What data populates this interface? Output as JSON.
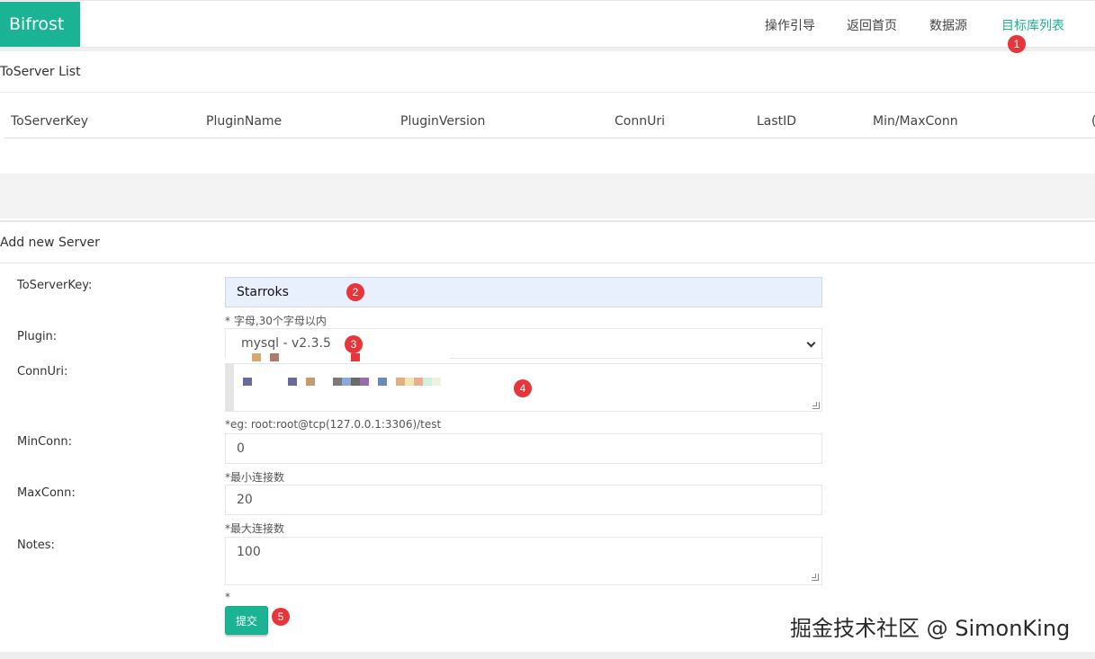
{
  "navbar": {
    "brand": "Bifrost",
    "items": [
      {
        "label": "操作引导"
      },
      {
        "label": "返回首页"
      },
      {
        "label": "数据源"
      },
      {
        "label": "目标库列表"
      }
    ],
    "active_color": "#1ab394"
  },
  "annotations": [
    "1",
    "2",
    "3",
    "4",
    "5"
  ],
  "list_panel": {
    "title": "ToServer List",
    "columns": [
      "ToServerKey",
      "PluginName",
      "PluginVersion",
      "ConnUri",
      "LastID",
      "Min/MaxConn",
      "("
    ]
  },
  "form_panel": {
    "title": "Add new Server",
    "fields": {
      "to_server_key": {
        "label": "ToServerKey:",
        "value": "Starroks",
        "help": "* 字母,30个字母以内"
      },
      "plugin": {
        "label": "Plugin:",
        "value": "mysql - v2.3.5"
      },
      "conn_uri": {
        "label": "ConnUri:",
        "value": "",
        "help": "*eg: root:root@tcp(127.0.0.1:3306)/test"
      },
      "min_conn": {
        "label": "MinConn:",
        "value": "0",
        "help": "*最小连接数"
      },
      "max_conn": {
        "label": "MaxConn:",
        "value": "20",
        "help": "*最大连接数"
      },
      "notes": {
        "label": "Notes:",
        "value": "100",
        "help": "*"
      }
    },
    "submit_label": "提交"
  },
  "watermark": "掘金技术社区 @ SimonKing",
  "colors": {
    "brand": "#1ab394",
    "badge": "#e8353a",
    "autofill": "#e8f0fe"
  }
}
